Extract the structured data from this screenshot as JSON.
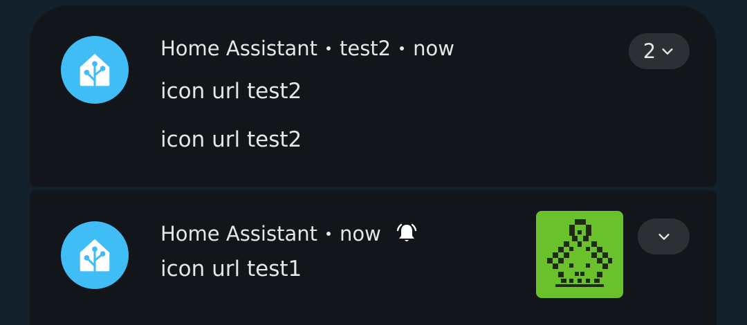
{
  "notifications": [
    {
      "app_name": "Home Assistant",
      "channel": "test2",
      "time": "now",
      "lines": [
        "icon url test2",
        "icon url test2"
      ],
      "group_count": "2",
      "icon": "home-assistant-icon",
      "icon_color": "#41bdf5"
    },
    {
      "app_name": "Home Assistant",
      "time": "now",
      "lines": [
        "icon url test1"
      ],
      "alert_icon": "bell-ringing-icon",
      "thumbnail_icon": "pixel-art-thumbnail",
      "thumbnail_color": "#6bc12c",
      "icon": "home-assistant-icon",
      "icon_color": "#41bdf5"
    }
  ]
}
